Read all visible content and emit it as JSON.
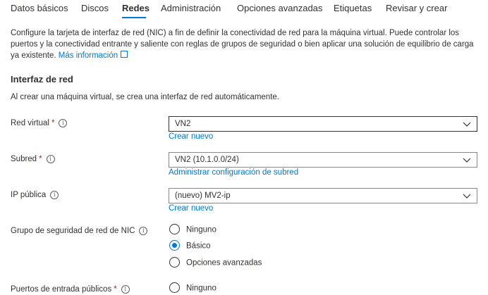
{
  "tabs": [
    {
      "label": "Datos básicos"
    },
    {
      "label": "Discos"
    },
    {
      "label": "Redes"
    },
    {
      "label": "Administración"
    },
    {
      "label": "Opciones avanzadas"
    },
    {
      "label": "Etiquetas"
    },
    {
      "label": "Revisar y crear"
    }
  ],
  "intro": {
    "text": "Configure la tarjeta de interfaz de red (NIC) a fin de definir la conectividad de red para la máquina virtual. Puede controlar los puertos y la conectividad entrante y saliente con reglas de grupos de seguridad o bien aplicar una solución de equilibrio de carga ya existente.",
    "more_link": "Más información"
  },
  "section": {
    "title": "Interfaz de red",
    "subtitle": "Al crear una máquina virtual, se crea una interfaz de red automáticamente."
  },
  "fields": {
    "vnet": {
      "label": "Red virtual",
      "required": "*",
      "value": "VN2",
      "link": "Crear nuevo"
    },
    "subnet": {
      "label": "Subred",
      "required": "*",
      "value": "VN2 (10.1.0.0/24)",
      "link": "Administrar configuración de subred"
    },
    "public_ip": {
      "label": "IP pública",
      "value": "(nuevo) MV2-ip",
      "link": "Crear nuevo"
    },
    "nsg": {
      "label": "Grupo de seguridad de red de NIC",
      "options": [
        "Ninguno",
        "Básico",
        "Opciones avanzadas"
      ],
      "selected": "Básico"
    },
    "ports": {
      "label": "Puertos de entrada públicos",
      "required": "*",
      "options": [
        "Ninguno"
      ]
    }
  },
  "colors": {
    "accent": "#0078d4",
    "required": "#a4262c",
    "text": "#323130"
  }
}
